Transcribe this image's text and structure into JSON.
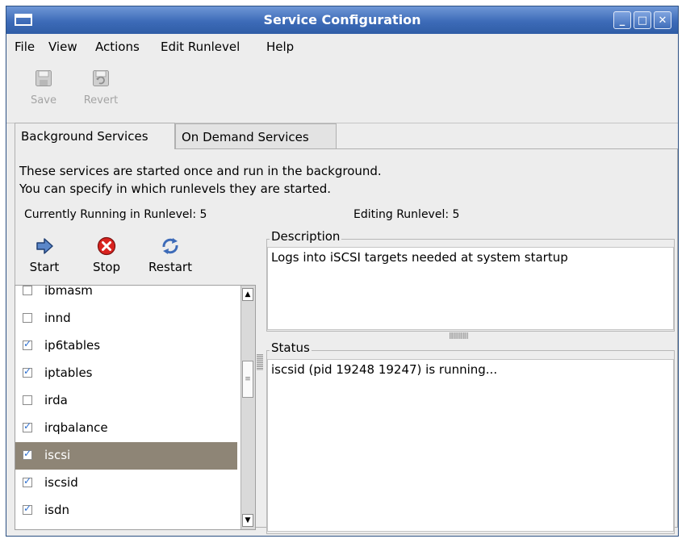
{
  "window": {
    "title": "Service Configuration",
    "controls": {
      "minimize": "_",
      "maximize": "□",
      "close": "✕"
    }
  },
  "menubar": {
    "items": [
      "File",
      "View",
      "Actions",
      "Edit Runlevel",
      "Help"
    ]
  },
  "toolbar": {
    "save_label": "Save",
    "revert_label": "Revert"
  },
  "tabs": [
    {
      "label": "Background Services",
      "active": true
    },
    {
      "label": "On Demand Services",
      "active": false
    }
  ],
  "info": {
    "line1": "These services are started once and run in the background.",
    "line2": "You can specify in which runlevels they are started.",
    "current_runlevel": "Currently Running in Runlevel: 5",
    "editing_runlevel": "Editing Runlevel: 5"
  },
  "service_toolbar": {
    "start_label": "Start",
    "stop_label": "Stop",
    "restart_label": "Restart"
  },
  "services": [
    {
      "name": "ibmasm",
      "checked": false,
      "selected": false
    },
    {
      "name": "innd",
      "checked": false,
      "selected": false
    },
    {
      "name": "ip6tables",
      "checked": true,
      "selected": false
    },
    {
      "name": "iptables",
      "checked": true,
      "selected": false
    },
    {
      "name": "irda",
      "checked": false,
      "selected": false
    },
    {
      "name": "irqbalance",
      "checked": true,
      "selected": false
    },
    {
      "name": "iscsi",
      "checked": true,
      "selected": true
    },
    {
      "name": "iscsid",
      "checked": true,
      "selected": false
    },
    {
      "name": "isdn",
      "checked": true,
      "selected": false
    }
  ],
  "description": {
    "label": "Description",
    "text": "Logs into iSCSI targets needed at system startup"
  },
  "status": {
    "label": "Status",
    "text": "iscsid (pid 19248 19247) is running..."
  },
  "colors": {
    "titlebar": "#3d6bb8",
    "selection": "#8e8576",
    "stop_icon": "#d9231f",
    "start_icon": "#3d6bb8"
  }
}
